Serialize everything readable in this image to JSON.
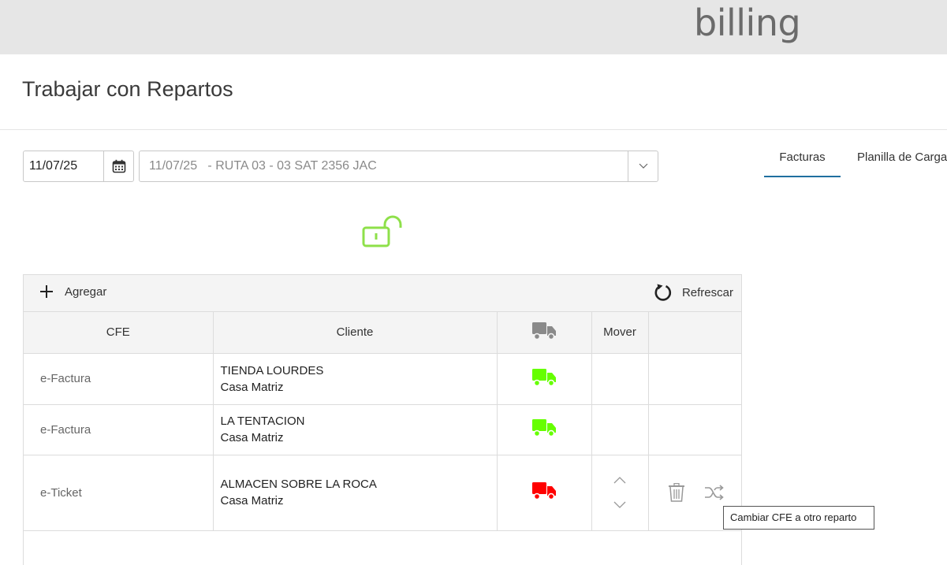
{
  "header": {
    "logo_text": "billing"
  },
  "page": {
    "title": "Trabajar con Repartos"
  },
  "filters": {
    "date_value": "11/07/25",
    "route_value": "11/07/25   - RUTA 03 - 03 SAT 2356 JAC"
  },
  "tabs": [
    {
      "label": "Facturas",
      "active": true
    },
    {
      "label": "Planilla de Carga",
      "active": false
    }
  ],
  "toolbar": {
    "add_label": "Agregar",
    "refresh_label": "Refrescar"
  },
  "table": {
    "columns": {
      "cfe": "CFE",
      "cliente": "Cliente",
      "mover": "Mover"
    },
    "rows": [
      {
        "cfe": "e-Factura",
        "client_name": "TIENDA LOURDES",
        "client_branch": "Casa Matriz",
        "truck_status_color": "#66ff00"
      },
      {
        "cfe": "e-Factura",
        "client_name": "LA TENTACION",
        "client_branch": "Casa Matriz",
        "truck_status_color": "#66ff00"
      },
      {
        "cfe": "e-Ticket",
        "client_name": "ALMACEN SOBRE LA ROCA",
        "client_branch": "Casa Matriz",
        "truck_status_color": "#ff0000"
      }
    ]
  },
  "tooltip": {
    "text": "Cambiar CFE a otro reparto"
  },
  "colors": {
    "lock": "#8ee04a",
    "header_truck": "#8a8a8a",
    "tab_underline": "#1f6f9f"
  }
}
